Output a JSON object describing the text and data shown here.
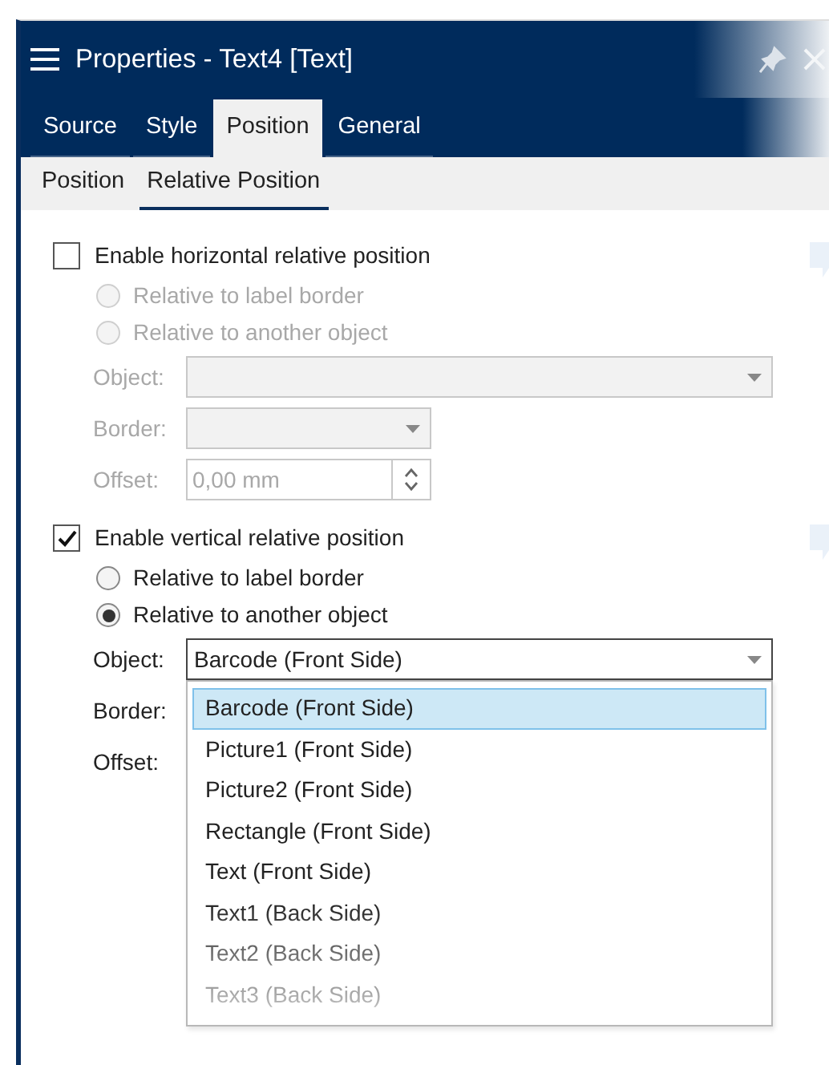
{
  "panel": {
    "title": "Properties - Text4 [Text]"
  },
  "tabs": [
    {
      "label": "Source",
      "selected": false
    },
    {
      "label": "Style",
      "selected": false
    },
    {
      "label": "Position",
      "selected": true
    },
    {
      "label": "General",
      "selected": false
    }
  ],
  "subtabs": [
    {
      "label": "Position",
      "selected": false
    },
    {
      "label": "Relative Position",
      "selected": true
    }
  ],
  "sections": [
    {
      "label": "Enable horizontal relative position",
      "checked": false,
      "options": [
        {
          "label": "Relative to label border",
          "selected": false
        },
        {
          "label": "Relative to another object",
          "selected": false
        }
      ],
      "fields": [
        {
          "kind": "dropdown",
          "label": "Object:"
        },
        {
          "kind": "dropdown",
          "label": "Border:"
        },
        {
          "kind": "spinner",
          "label": "Offset:",
          "value": "0,00 mm"
        }
      ]
    },
    {
      "label": "Enable vertical relative position",
      "checked": true,
      "options": [
        {
          "label": "Relative to label border",
          "selected": false
        },
        {
          "label": "Relative to another object",
          "selected": true
        }
      ],
      "fields": [
        {
          "kind": "dropdown",
          "label": "Object:",
          "value": "Barcode (Front Side)",
          "expanded": true,
          "items": [
            {
              "label": "Barcode (Front Side)",
              "selected": true
            },
            {
              "label": "Picture1 (Front Side)",
              "selected": false
            },
            {
              "label": "Picture2 (Front Side)",
              "selected": false
            },
            {
              "label": "Rectangle (Front Side)",
              "selected": false
            },
            {
              "label": "Text (Front Side)",
              "selected": false
            },
            {
              "label": "Text1 (Back Side)",
              "selected": false
            },
            {
              "label": "Text2 (Back Side)",
              "selected": false
            },
            {
              "label": "Text3 (Back Side)",
              "selected": false
            }
          ]
        },
        {
          "kind": "label",
          "label": "Border:"
        },
        {
          "kind": "label",
          "label": "Offset:"
        }
      ]
    }
  ]
}
